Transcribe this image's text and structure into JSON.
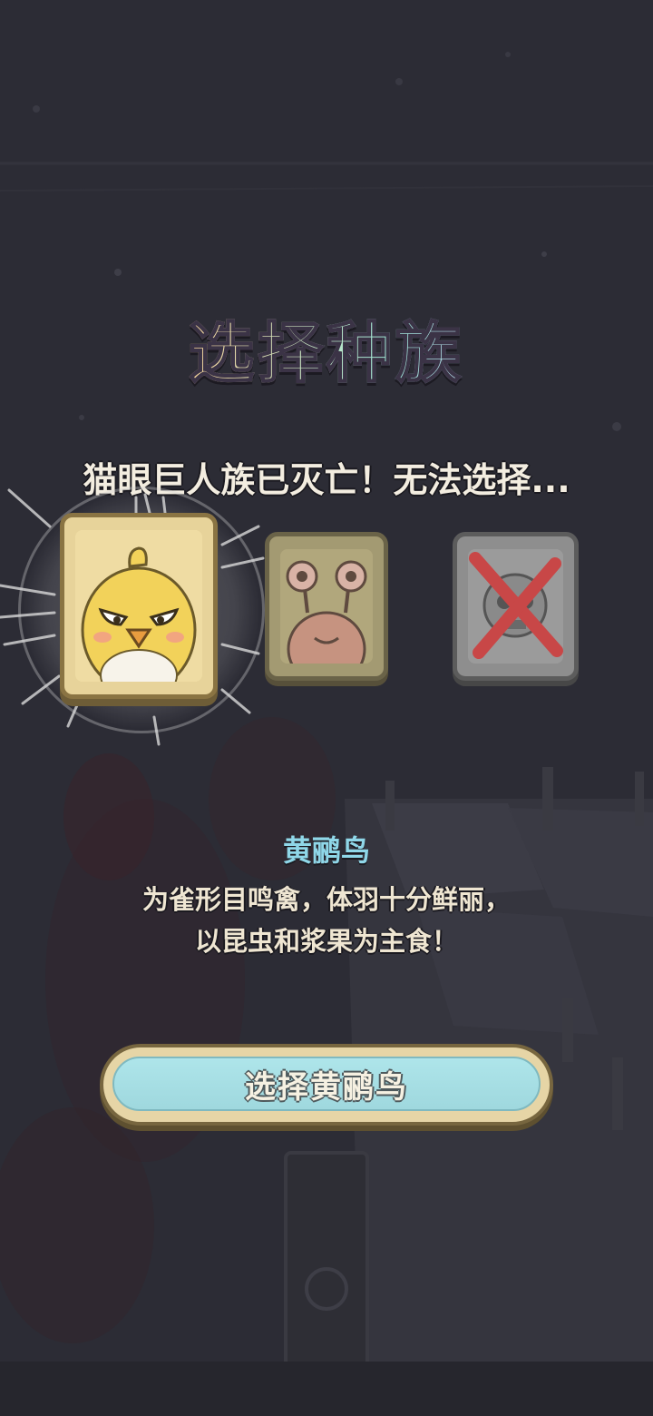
{
  "screen": {
    "title": "选择种族",
    "notice": "猫眼巨人族已灭亡！无法选择..."
  },
  "races": [
    {
      "id": "bird",
      "icon": "yellow-bird-icon",
      "state": "selected"
    },
    {
      "id": "slug",
      "icon": "snail-creature-icon",
      "state": "available"
    },
    {
      "id": "cat-eye-giant",
      "icon": "crossed-out-skull-icon",
      "state": "extinct"
    }
  ],
  "selected_race": {
    "name": "黄鹂鸟",
    "description_lines": [
      "为雀形目鸣禽，体羽十分鲜丽，",
      "以昆虫和浆果为主食！"
    ]
  },
  "confirm_button": {
    "label": "选择黄鹂鸟"
  },
  "colors": {
    "background": "#2d2d35",
    "race_name": "#8fd7e8",
    "button_fill": "#aee5ea"
  }
}
